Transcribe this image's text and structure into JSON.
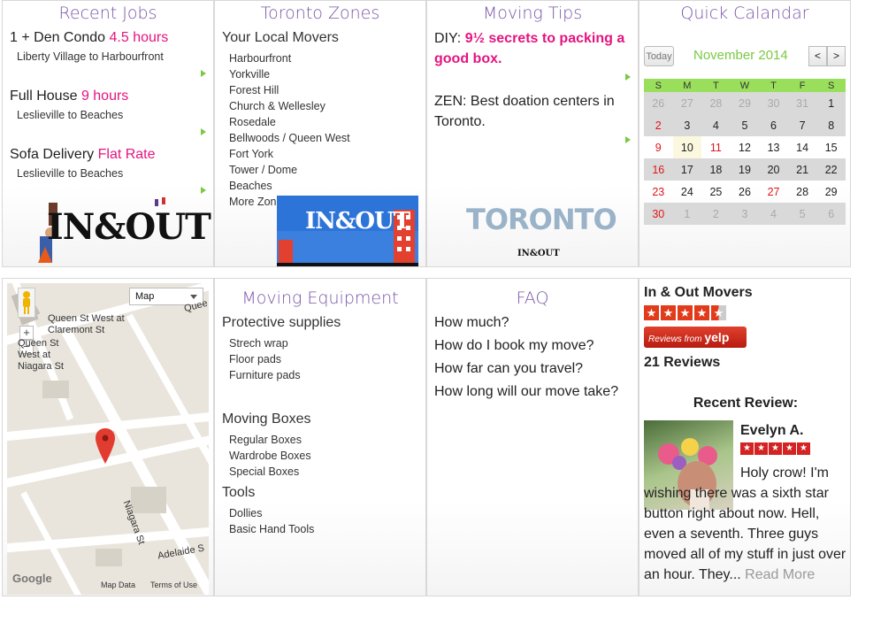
{
  "recent_jobs": {
    "heading": "Recent Jobs",
    "items": [
      {
        "title": "1 + Den Condo",
        "highlight": "4.5 hours",
        "route": "Liberty Village to Harbourfront"
      },
      {
        "title": "Full House",
        "highlight": "9 hours",
        "route": "Leslieville to Beaches"
      },
      {
        "title": "Sofa Delivery",
        "highlight": "Flat Rate",
        "route": "Leslieville to Beaches"
      }
    ]
  },
  "zones": {
    "heading": "Toronto Zones",
    "subheading": "Your Local Movers",
    "items": [
      "Harbourfront",
      "Yorkville",
      "Forest Hill",
      "Church & Wellesley",
      "Rosedale",
      "Bellwoods / Queen West",
      "Fort York",
      "Tower / Dome",
      "Beaches",
      "More Zones"
    ]
  },
  "tips": {
    "heading": "Moving Tips",
    "tip1_prefix": "DIY:",
    "tip1_highlight": "9½ secrets to packing a good box.",
    "tip2": "ZEN: Best doation centers in Toronto."
  },
  "calendar": {
    "heading": "Quick Calandar",
    "today_label": "Today",
    "month": "November 2014",
    "prev": "<",
    "next": ">",
    "days": [
      "S",
      "M",
      "T",
      "W",
      "T",
      "F",
      "S"
    ],
    "weeks": [
      [
        "26",
        "27",
        "28",
        "29",
        "30",
        "31",
        "1"
      ],
      [
        "2",
        "3",
        "4",
        "5",
        "6",
        "7",
        "8"
      ],
      [
        "9",
        "10",
        "11",
        "12",
        "13",
        "14",
        "15"
      ],
      [
        "16",
        "17",
        "18",
        "19",
        "20",
        "21",
        "22"
      ],
      [
        "23",
        "24",
        "25",
        "26",
        "27",
        "28",
        "29"
      ],
      [
        "30",
        "1",
        "2",
        "3",
        "4",
        "5",
        "6"
      ]
    ]
  },
  "logos": {
    "inout_text": "IN&OUT",
    "toronto_text": "TORONTO",
    "toronto_small": "IN&OUT"
  },
  "map": {
    "toggle_label": "Map",
    "labels": [
      "Queen St West at Claremont St",
      "Queen St West at Niagara St",
      "Niagara St",
      "Adelaide S",
      "Quee"
    ],
    "footer_google": "Google",
    "footer_data": "Map Data",
    "footer_terms": "Terms of Use",
    "zoom_in": "+",
    "zoom_out": "−"
  },
  "equipment": {
    "heading": "Moving Equipment",
    "groups": [
      {
        "title": "Protective supplies",
        "items": [
          "Strech wrap",
          "Floor pads",
          "Furniture pads"
        ]
      },
      {
        "title": "Moving Boxes",
        "items": [
          "Regular Boxes",
          "Wardrobe Boxes",
          "Special Boxes"
        ]
      },
      {
        "title": "Tools",
        "items": [
          "Dollies",
          "Basic Hand Tools"
        ]
      }
    ]
  },
  "faq": {
    "heading": "FAQ",
    "questions": [
      "How much?",
      "How do I book my move?",
      "How far can you travel?",
      "How long will our move take?"
    ]
  },
  "reviews": {
    "business": "In & Out Movers",
    "rating": 4.5,
    "badge_text": "Reviews from",
    "badge_brand": "yelp",
    "count_text": "21 Reviews",
    "recent_label": "Recent Review:",
    "reviewer": "Evelyn A.",
    "reviewer_rating": 5,
    "text": "Holy crow! I'm wishing there was a sixth star button right about now. Hell, even a seventh. Three guys moved all of my stuff in just over an hour. They...",
    "read_more": "Read More"
  },
  "colors": {
    "heading": "#7a55a8",
    "highlight": "#e5137f",
    "green": "#7ac943",
    "yelp_red": "#d32323"
  }
}
